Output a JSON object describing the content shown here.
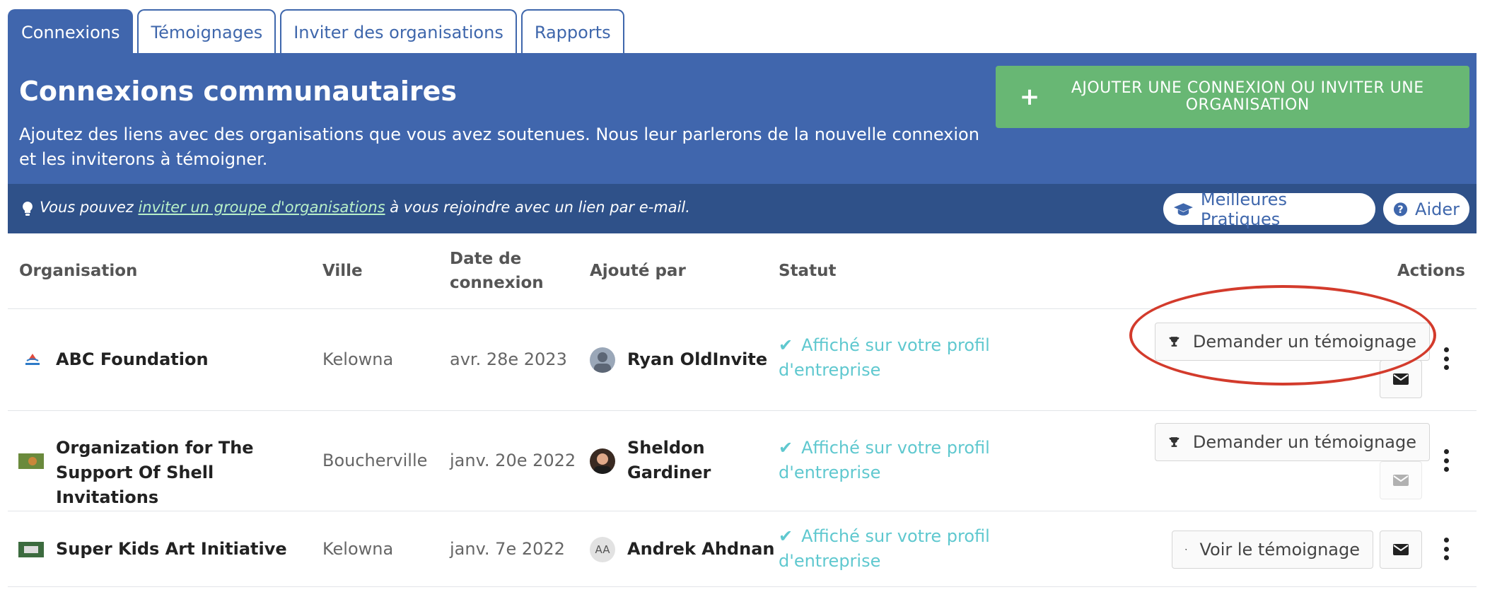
{
  "tabs": [
    {
      "label": "Connexions",
      "active": true
    },
    {
      "label": "Témoignages",
      "active": false
    },
    {
      "label": "Inviter des organisations",
      "active": false
    },
    {
      "label": "Rapports",
      "active": false
    }
  ],
  "header": {
    "title": "Connexions communautaires",
    "description": "Ajoutez des liens avec des organisations que vous avez soutenues. Nous leur parlerons de la nouvelle connexion et les inviterons à témoigner.",
    "add_button_label": "Ajouter une connexion ou inviter une organisation",
    "add_button_icon": "plus-icon"
  },
  "tip": {
    "icon": "lightbulb-icon",
    "before": "Vous pouvez ",
    "link": "inviter un groupe d'organisations",
    "after": " à vous rejoindre avec un lien par e-mail."
  },
  "help_links": {
    "best_practices": "Meilleures Pratiques",
    "best_practices_icon": "graduation-cap-icon",
    "help": "Aider",
    "help_icon": "question-circle-icon"
  },
  "table": {
    "columns": [
      "Organisation",
      "Ville",
      "Date de connexion",
      "Ajouté par",
      "Statut",
      "Actions"
    ],
    "rows": [
      {
        "organisation": "ABC Foundation",
        "ville": "Kelowna",
        "date": "avr. 28e 2023",
        "added_by": "Ryan OldInvite",
        "status": "Affiché sur votre profil d'entreprise",
        "action": "Demander un témoignage",
        "mail_enabled": true
      },
      {
        "organisation": "Organization for The Support Of Shell Invitations",
        "ville": "Boucherville",
        "date": "janv. 20e 2022",
        "added_by": "Sheldon Gardiner",
        "status": "Affiché sur votre profil d'entreprise",
        "action": "Demander un témoignage",
        "mail_enabled": false
      },
      {
        "organisation": "Super Kids Art Initiative",
        "ville": "Kelowna",
        "date": "janv. 7e 2022",
        "added_by": "Andrek Ahdnan",
        "added_by_initials": "AA",
        "status": "Affiché sur votre profil d'entreprise",
        "action": "Voir le témoignage",
        "mail_enabled": true
      }
    ]
  },
  "colors": {
    "brand_blue": "#4066ad",
    "tip_bar": "#2f5189",
    "add_green": "#68b774",
    "status_teal": "#5fc8cf",
    "highlight_red": "#d33b2c"
  }
}
